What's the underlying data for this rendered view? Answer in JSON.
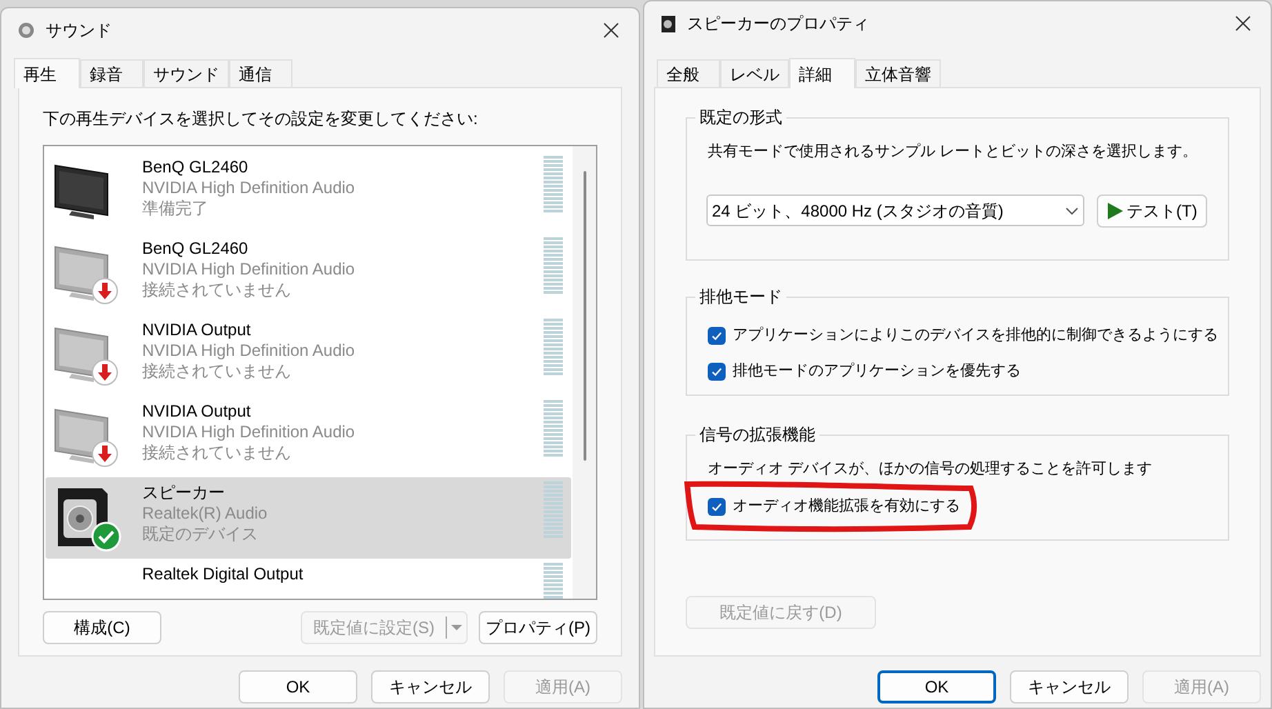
{
  "sound_window": {
    "title": "サウンド",
    "tabs": [
      {
        "label": "再生",
        "selected": true
      },
      {
        "label": "録音",
        "selected": false
      },
      {
        "label": "サウンド",
        "selected": false
      },
      {
        "label": "通信",
        "selected": false
      }
    ],
    "instruction": "下の再生デバイスを選択してその設定を変更してください:",
    "devices": [
      {
        "kind": "monitor",
        "disconnected": false,
        "default_device": false,
        "selected": false,
        "name": "BenQ GL2460",
        "driver": "NVIDIA High Definition Audio",
        "status": "準備完了"
      },
      {
        "kind": "monitor",
        "disconnected": true,
        "default_device": false,
        "selected": false,
        "name": "BenQ GL2460",
        "driver": "NVIDIA High Definition Audio",
        "status": "接続されていません"
      },
      {
        "kind": "monitor",
        "disconnected": true,
        "default_device": false,
        "selected": false,
        "name": "NVIDIA Output",
        "driver": "NVIDIA High Definition Audio",
        "status": "接続されていません"
      },
      {
        "kind": "monitor",
        "disconnected": true,
        "default_device": false,
        "selected": false,
        "name": "NVIDIA Output",
        "driver": "NVIDIA High Definition Audio",
        "status": "接続されていません"
      },
      {
        "kind": "speaker",
        "disconnected": false,
        "default_device": true,
        "selected": true,
        "name": "スピーカー",
        "driver": "Realtek(R) Audio",
        "status": "既定のデバイス"
      },
      {
        "selected": false,
        "name": "Realtek Digital Output"
      }
    ],
    "configure_button": {
      "label": "構成(C)",
      "disabled": false
    },
    "set_default_button": {
      "label": "既定値に設定(S)",
      "disabled": true
    },
    "properties_button": {
      "label": "プロパティ(P)",
      "disabled": false
    },
    "footer_buttons": [
      {
        "label": "OK",
        "disabled": false,
        "focused": false
      },
      {
        "label": "キャンセル",
        "disabled": false,
        "focused": false
      },
      {
        "label": "適用(A)",
        "disabled": true,
        "focused": false
      }
    ]
  },
  "properties_window": {
    "title": "スピーカーのプロパティ",
    "tabs": [
      {
        "label": "全般",
        "selected": false
      },
      {
        "label": "レベル",
        "selected": false
      },
      {
        "label": "詳細",
        "selected": true
      },
      {
        "label": "立体音響",
        "selected": false
      }
    ],
    "default_format": {
      "title": "既定の形式",
      "description": "共有モードで使用されるサンプル レートとビットの深さを選択します。",
      "format_value": "24 ビット、48000 Hz (スタジオの音質)",
      "test_button": "テスト(T)"
    },
    "exclusive_mode": {
      "title": "排他モード",
      "options": [
        {
          "label": "アプリケーションによりこのデバイスを排他的に制御できるようにする",
          "checked": true
        },
        {
          "label": "排他モードのアプリケーションを優先する",
          "checked": true
        }
      ]
    },
    "signal_enhancements": {
      "title": "信号の拡張機能",
      "description": "オーディオ デバイスが、ほかの信号の処理することを許可します",
      "options": [
        {
          "label": "オーディオ機能拡張を有効にする",
          "checked": true,
          "circled": true
        }
      ]
    },
    "restore_button": {
      "label": "既定値に戻す(D)",
      "disabled": true
    },
    "footer_buttons": [
      {
        "label": "OK",
        "disabled": false,
        "focused": true
      },
      {
        "label": "キャンセル",
        "disabled": false,
        "focused": false
      },
      {
        "label": "適用(A)",
        "disabled": true,
        "focused": false
      }
    ]
  }
}
